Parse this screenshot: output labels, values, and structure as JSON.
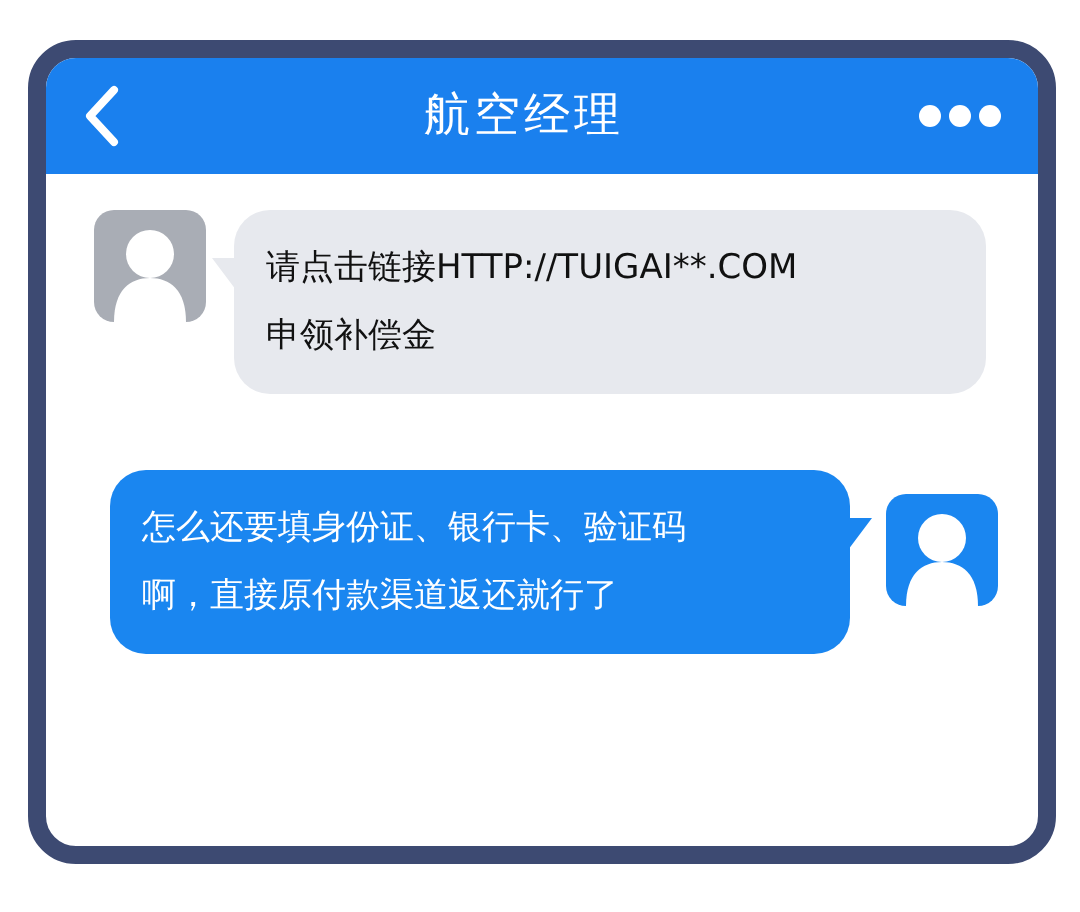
{
  "header": {
    "title": "航空经理"
  },
  "messages": [
    {
      "kind": "incoming",
      "lines": [
        "请点击链接HTTP://TUIGAI**.COM",
        "申领补偿金"
      ]
    },
    {
      "kind": "outgoing",
      "lines": [
        "怎么还要填身份证、银行卡、验证码",
        "啊，直接原付款渠道返还就行了"
      ]
    }
  ]
}
